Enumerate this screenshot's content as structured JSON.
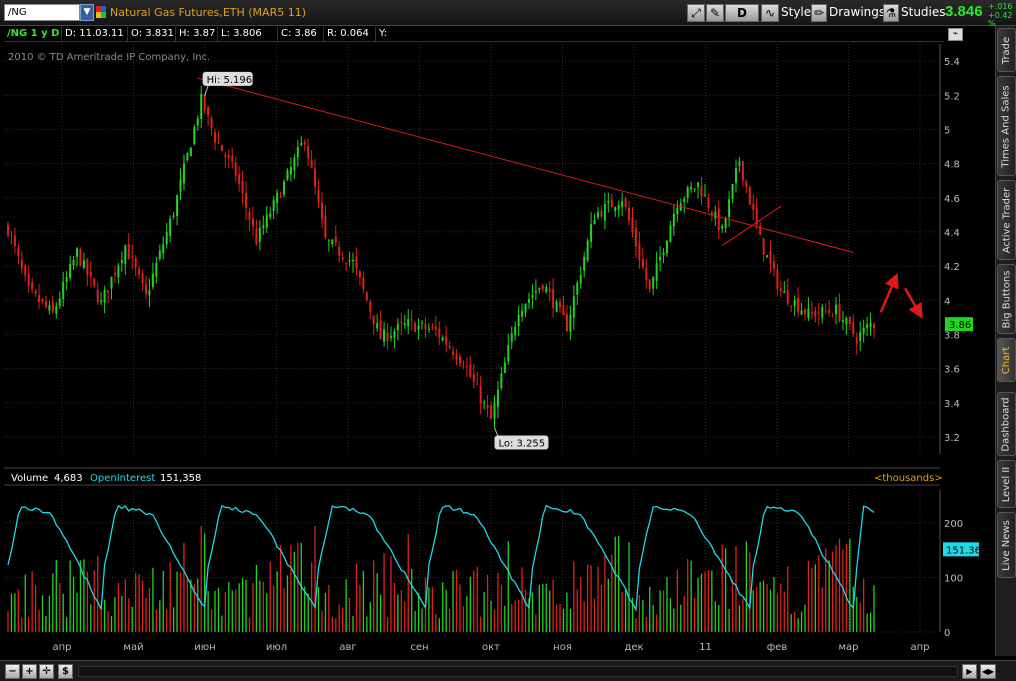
{
  "toolbar": {
    "symbol": "/NG",
    "title": "Natural Gas Futures,ETH (MAR5 11)",
    "period": "D",
    "style_label": "Style",
    "drawings_label": "Drawings",
    "studies_label": "Studies",
    "last_price": "3.846",
    "change_abs": "+.016",
    "change_pct": "+0.42 %"
  },
  "info": {
    "symbol_period": "/NG 1 y D",
    "date": "D: 11.03.11",
    "open": "O: 3.831",
    "high": "H: 3.87",
    "low": "L: 3.806",
    "close": "C: 3.86",
    "range": "R: 0.064",
    "y": "Y:"
  },
  "copyright": "2010 © TD Ameritrade IP Company, Inc.",
  "side_tabs": [
    "Trade",
    "Times And Sales",
    "Active Trader",
    "Big Buttons",
    "Chart",
    "Dashboard",
    "Level II",
    "Live News"
  ],
  "volume_header": {
    "volume_label": "Volume",
    "volume_value": "4,683",
    "oi_label": "OpenInterest",
    "oi_value": "151,358",
    "units": "<thousands>"
  },
  "chart_data": {
    "type": "candlestick",
    "price_axis": {
      "ylim": [
        3.1,
        5.5
      ],
      "ticks": [
        "5.4",
        "5.2",
        "5",
        "4.8",
        "4.6",
        "4.4",
        "4.2",
        "4",
        "3.8",
        "3.6",
        "3.4",
        "3.2"
      ]
    },
    "volume_axis": {
      "ylim": [
        0,
        260
      ],
      "ticks": [
        "200",
        "100",
        "0"
      ]
    },
    "month_labels": [
      "апр",
      "май",
      "июн",
      "июл",
      "авг",
      "сен",
      "окт",
      "ноя",
      "дек",
      "11",
      "фев",
      "мар",
      "апр"
    ],
    "high_label": "Hi: 5.196",
    "low_label": "Lo: 3.255",
    "last_label": "3.86",
    "oi_last_label": "151.36",
    "colors": {
      "up": "#1fd51f",
      "down": "#e0201a",
      "oi": "#20d8e8",
      "trend": "#e01818",
      "grid": "#2b2b2b"
    },
    "anchors": [
      [
        0,
        4.42
      ],
      [
        6,
        4.05
      ],
      [
        13,
        3.92
      ],
      [
        20,
        4.28
      ],
      [
        27,
        3.98
      ],
      [
        34,
        4.32
      ],
      [
        40,
        4.02
      ],
      [
        48,
        4.52
      ],
      [
        56,
        5.17
      ],
      [
        60,
        4.95
      ],
      [
        66,
        4.74
      ],
      [
        72,
        4.35
      ],
      [
        80,
        4.68
      ],
      [
        86,
        4.95
      ],
      [
        92,
        4.35
      ],
      [
        100,
        4.22
      ],
      [
        108,
        3.78
      ],
      [
        116,
        3.86
      ],
      [
        124,
        3.82
      ],
      [
        132,
        3.64
      ],
      [
        140,
        3.3
      ],
      [
        148,
        3.95
      ],
      [
        155,
        4.1
      ],
      [
        162,
        3.85
      ],
      [
        170,
        4.5
      ],
      [
        178,
        4.6
      ],
      [
        186,
        4.05
      ],
      [
        194,
        4.58
      ],
      [
        200,
        4.68
      ],
      [
        207,
        4.4
      ],
      [
        212,
        4.82
      ],
      [
        218,
        4.35
      ],
      [
        224,
        4.05
      ],
      [
        232,
        3.92
      ],
      [
        240,
        3.94
      ],
      [
        246,
        3.78
      ],
      [
        250,
        3.86
      ]
    ],
    "trendlines": [
      {
        "from": [
          55,
          5.3
        ],
        "to": [
          245,
          4.28
        ]
      },
      {
        "from": [
          207,
          4.32
        ],
        "to": [
          224,
          4.55
        ]
      }
    ],
    "arrows": [
      {
        "from": [
          253,
          3.93
        ],
        "to": [
          257,
          4.12
        ]
      },
      {
        "from": [
          260,
          4.07
        ],
        "to": [
          264,
          3.93
        ]
      }
    ],
    "hi_point": [
      57,
      5.196
    ],
    "lo_point": [
      141,
      3.255
    ]
  }
}
